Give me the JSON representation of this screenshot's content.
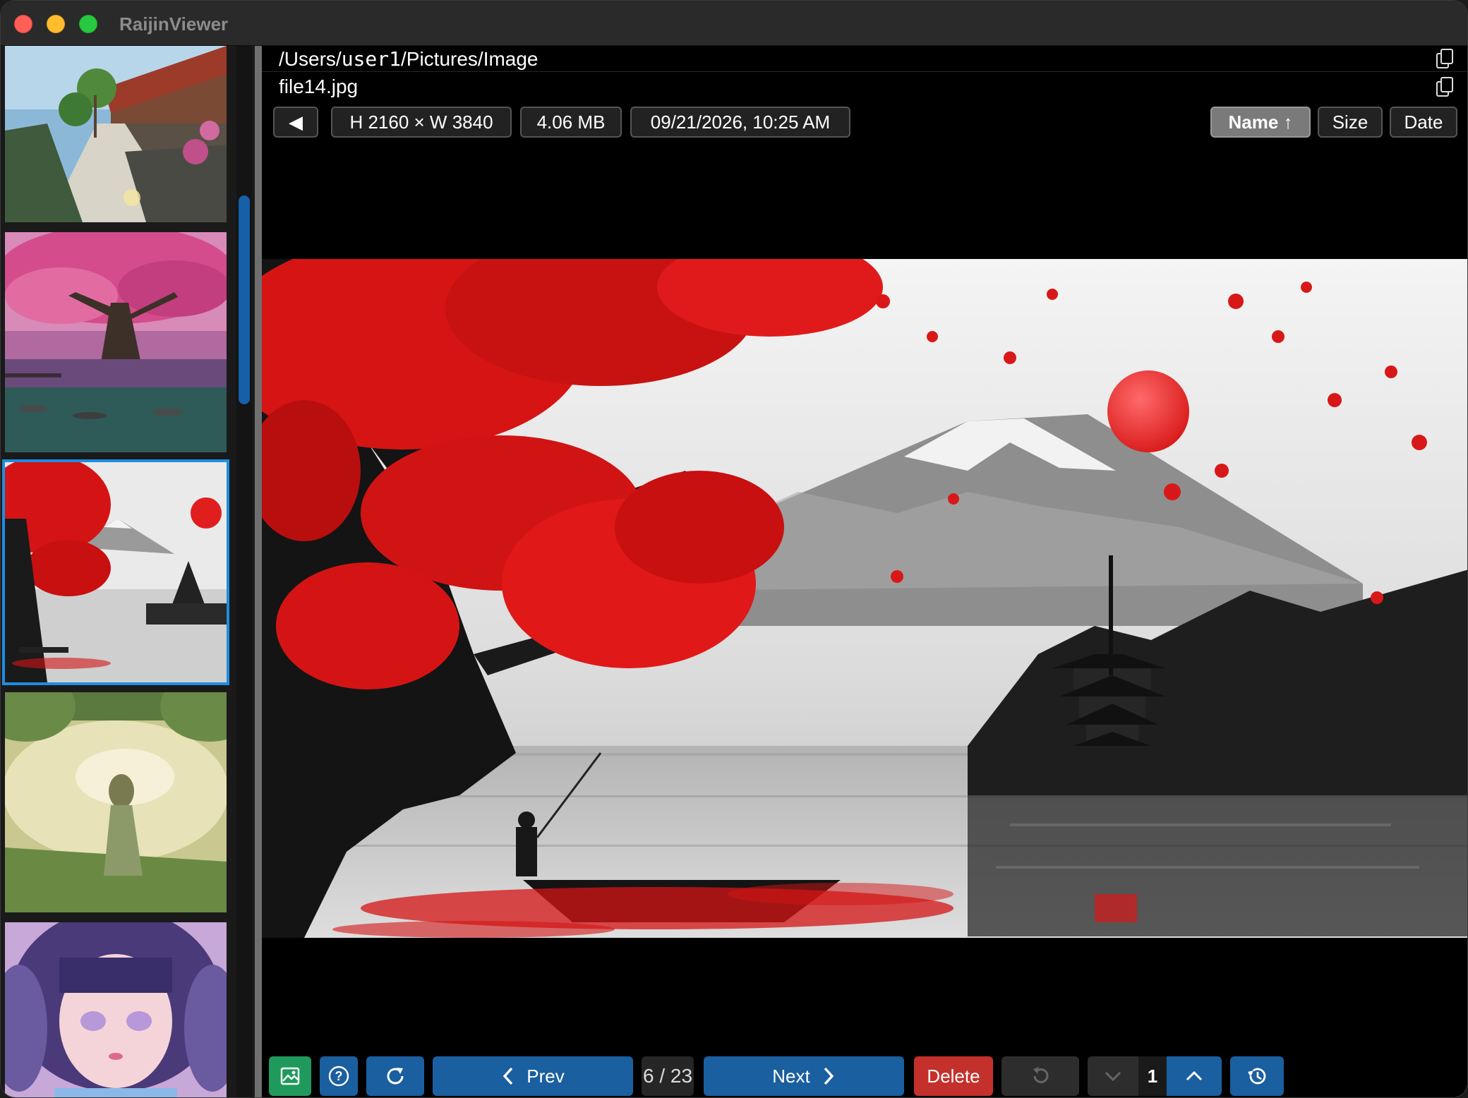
{
  "app": {
    "title": "RaijinViewer"
  },
  "header": {
    "path_prefix": "/Users/",
    "path_user": "user1",
    "path_suffix": "/Pictures/Image",
    "filename": "file14.jpg"
  },
  "info": {
    "back_symbol": "◀",
    "dimensions": "H 2160 × W 3840",
    "size": "4.06 MB",
    "date": "09/21/2026, 10:25 AM"
  },
  "sort": {
    "name_label": "Name ↑",
    "size_label": "Size",
    "date_label": "Date",
    "active": "name"
  },
  "thumbnails": [
    {
      "subject": "village path"
    },
    {
      "subject": "cherry blossom tree"
    },
    {
      "subject": "red maple and mount fuji",
      "selected": true
    },
    {
      "subject": "girl in sunlit field"
    },
    {
      "subject": "anime girl portrait"
    }
  ],
  "toolbar": {
    "prev_label": "Prev",
    "counter": "6 / 23",
    "next_label": "Next",
    "delete_label": "Delete",
    "page_number": "1"
  },
  "colors": {
    "accent_blue": "#1a5fa0",
    "selection_blue": "#1f8de0",
    "delete_red": "#c4302b",
    "image_green": "#1f9a5c"
  }
}
